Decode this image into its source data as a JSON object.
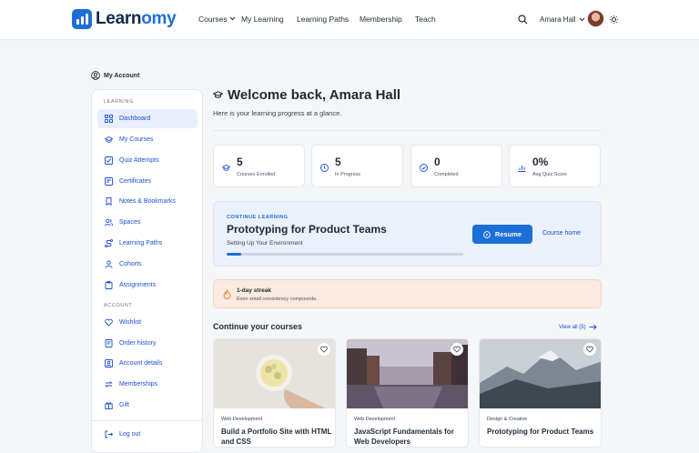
{
  "brand": {
    "name_part1": "Learn",
    "name_part2": "omy"
  },
  "nav": {
    "courses": "Courses",
    "my_learning": "My Learning",
    "learning_paths": "Learning Paths",
    "membership": "Membership",
    "teach": "Teach"
  },
  "user": {
    "name": "Amara Hall"
  },
  "account_label": "My Account",
  "sidebar": {
    "section_learning": "LEARNING",
    "learning_items": [
      {
        "label": "Dashboard",
        "icon": "grid-icon",
        "active": true
      },
      {
        "label": "My Courses",
        "icon": "graduation-cap-icon"
      },
      {
        "label": "Quiz Attempts",
        "icon": "checklist-icon"
      },
      {
        "label": "Certificates",
        "icon": "certificate-icon"
      },
      {
        "label": "Notes & Bookmarks",
        "icon": "bookmark-icon"
      },
      {
        "label": "Spaces",
        "icon": "users-icon"
      },
      {
        "label": "Learning Paths",
        "icon": "route-icon"
      },
      {
        "label": "Cohorts",
        "icon": "people-icon"
      },
      {
        "label": "Assignments",
        "icon": "clipboard-icon"
      }
    ],
    "section_account": "ACCOUNT",
    "account_items": [
      {
        "label": "Wishlist",
        "icon": "heart-icon"
      },
      {
        "label": "Order history",
        "icon": "receipt-icon"
      },
      {
        "label": "Account details",
        "icon": "user-icon"
      },
      {
        "label": "Memberships",
        "icon": "repeat-icon"
      },
      {
        "label": "Gift",
        "icon": "gift-icon"
      }
    ],
    "logout": "Log out"
  },
  "main": {
    "welcome": "Welcome back, Amara Hall",
    "subtitle": "Here is your learning progress at a glance."
  },
  "stats": [
    {
      "value": "5",
      "label": "Courses Enrolled",
      "icon": "graduation-cap-icon"
    },
    {
      "value": "5",
      "label": "In Progress",
      "icon": "clock-icon"
    },
    {
      "value": "0",
      "label": "Completed",
      "icon": "check-circle-icon"
    },
    {
      "value": "0%",
      "label": "Avg Quiz Score",
      "icon": "bar-chart-icon"
    }
  ],
  "continue": {
    "kicker": "CONTINUE LEARNING",
    "title": "Prototyping for Product Teams",
    "lesson": "Setting Up Your Environment",
    "progress_fraction": 0.06,
    "resume": "Resume",
    "course_home": "Course home"
  },
  "streak": {
    "title": "1-day streak",
    "text": "Even small consistency compounds."
  },
  "courses_section": {
    "title": "Continue your courses",
    "view_all": "View all (5)"
  },
  "course_cards": [
    {
      "category": "Web Development",
      "title": "Build a Portfolio Site with HTML and CSS"
    },
    {
      "category": "Web Development",
      "title": "JavaScript Fundamentals for Web Developers"
    },
    {
      "category": "Design & Creative",
      "title": "Prototyping for Product Teams"
    }
  ],
  "colors": {
    "accent": "#1d6fd8",
    "streak_bg": "#fbeadf",
    "continue_bg": "#eaf1fb"
  }
}
